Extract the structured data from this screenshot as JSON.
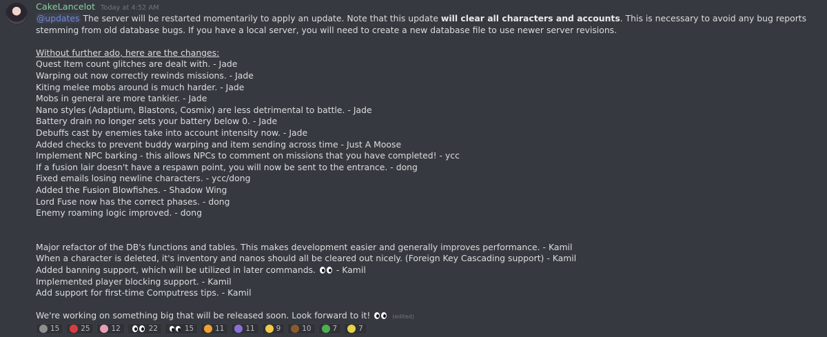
{
  "message": {
    "author": "CakeLancelot",
    "timestamp": "Today at 4:52 AM",
    "intro": {
      "mention": "@updates",
      "pre_bold": " The server will be restarted momentarily to apply an update. Note that this update ",
      "bold": "will clear all characters and accounts",
      "post_bold": ". This is necessary to avoid any bug reports stemming from old database bugs. If you have a local server, you will need to create a new database file to use newer server revisions."
    },
    "changes_heading": "Without further ado, here are the changes:",
    "changes": [
      "Quest Item count glitches are dealt with. -  Jade",
      "Warping out now correctly rewinds missions. - Jade",
      "Kiting melee mobs around is much harder. - Jade",
      "Mobs in general are more tankier. - Jade",
      "Nano styles (Adaptium, Blastons, Cosmix) are less detrimental to battle. - Jade",
      "Battery drain no longer sets your battery below 0. - Jade",
      "Debuffs cast by enemies take into account intensity now. - Jade",
      "Added checks to prevent buddy warping and item sending across time - Just A Moose",
      "Implement NPC barking - this allows NPCs to comment on missions that you have completed! - ycc",
      "If a fusion lair doesn't have a respawn point, you will now be sent to the entrance. - dong",
      "Fixed emails losing newline characters. - ycc/dong",
      "Added the Fusion Blowfishes. - Shadow Wing",
      "Lord Fuse now has the correct phases. - dong",
      "Enemy roaming logic improved. - dong"
    ],
    "db_changes": [
      "Major refactor of the DB's functions and tables. This makes development easier and generally improves performance. - Kamil",
      "When a character is deleted, it's inventory and nanos should all be cleared out nicely. (Foreign Key Cascading support) - Kamil"
    ],
    "banning": {
      "text": "Added banning support, which will be utilized in later commands.",
      "suffix": " - Kamil"
    },
    "more_changes": [
      "Implemented player blocking support. - Kamil",
      "Add support for first-time Computress tips. - Kamil"
    ],
    "closing": {
      "text": "We're working on something big that will be released soon. Look forward to it!",
      "edited": "(edited)"
    }
  },
  "reactions": [
    {
      "icon": "custom-emoji",
      "color": "#8e8e8e",
      "count": "15"
    },
    {
      "icon": "red-emoji",
      "color": "#d83c3e",
      "count": "25"
    },
    {
      "icon": "pink-emoji",
      "color": "#e8a0b0",
      "count": "12"
    },
    {
      "icon": "eyes-emoji",
      "color": "#ffffff",
      "count": "22"
    },
    {
      "icon": "eyes-small-emoji",
      "color": "#ffffff",
      "count": "15"
    },
    {
      "icon": "orange-emoji",
      "color": "#f0a030",
      "count": "11"
    },
    {
      "icon": "purple-emoji",
      "color": "#8a6ed8",
      "count": "11"
    },
    {
      "icon": "smiley-emoji",
      "color": "#f2c94c",
      "count": "9"
    },
    {
      "icon": "avatar-emoji",
      "color": "#8b5a2b",
      "count": "10"
    },
    {
      "icon": "green-emoji",
      "color": "#4caf50",
      "count": "7"
    },
    {
      "icon": "yellow-emoji",
      "color": "#e6d34a",
      "count": "7"
    }
  ]
}
